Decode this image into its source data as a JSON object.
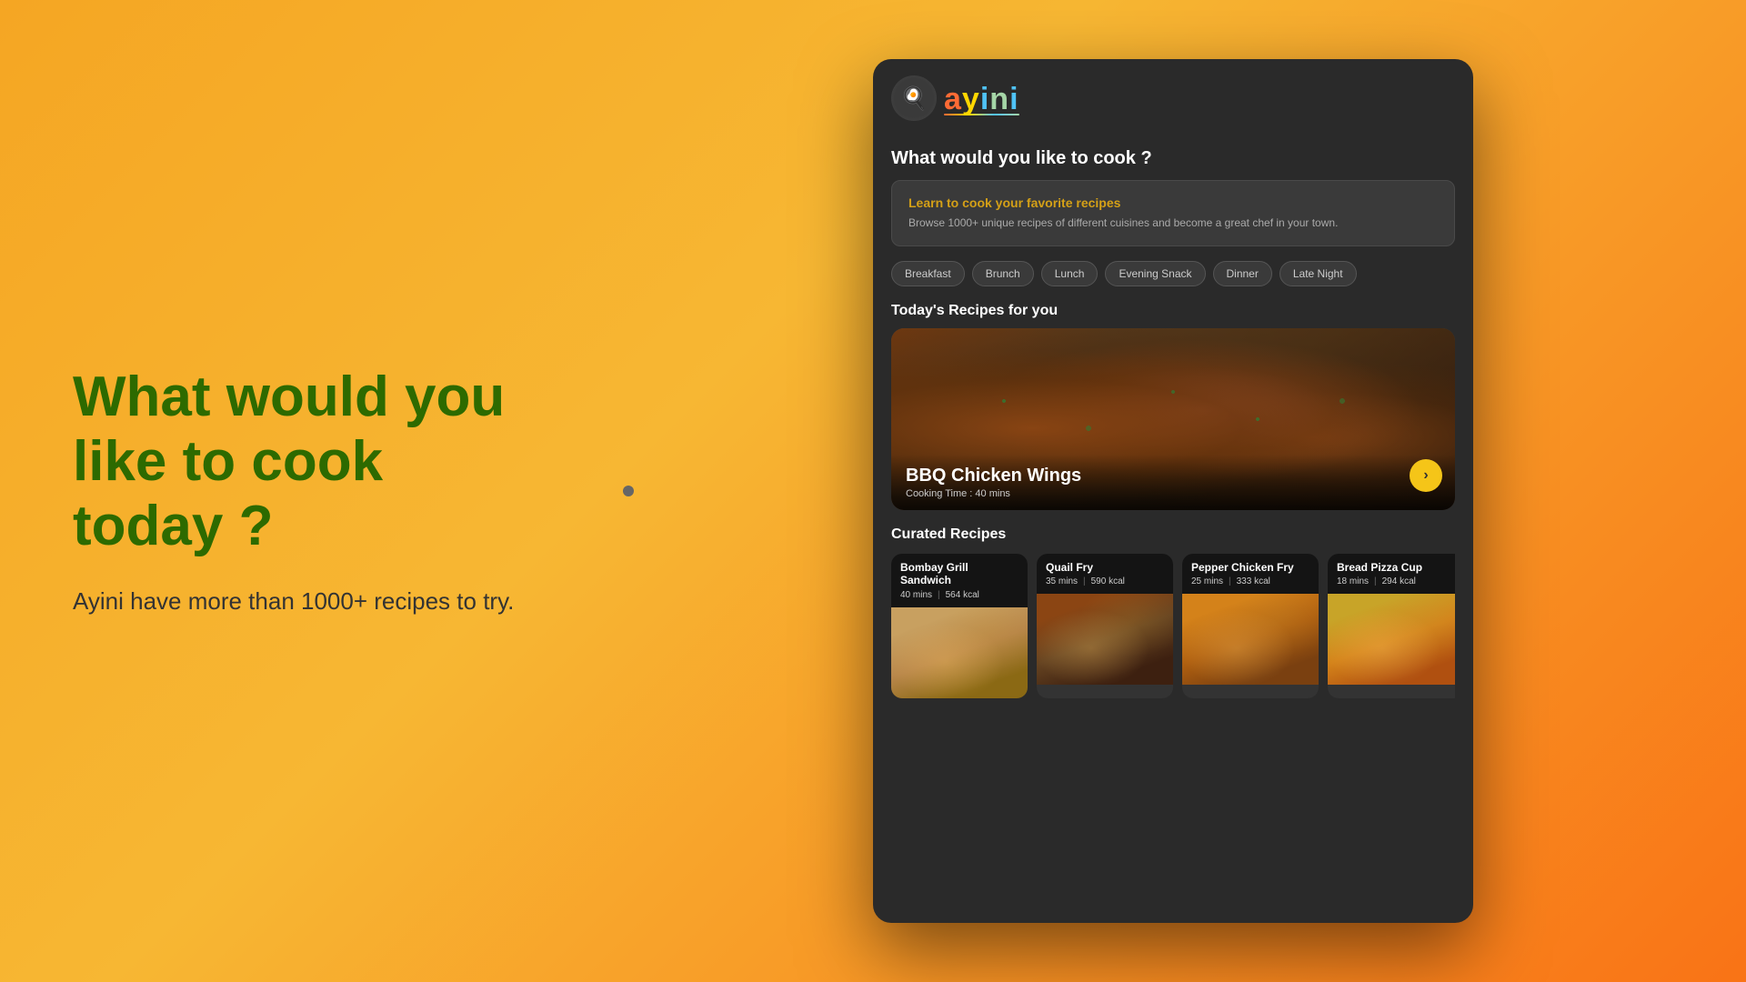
{
  "background": {
    "gradient_start": "#f5a623",
    "gradient_end": "#f97316"
  },
  "left": {
    "title": "What would you like to cook today ?",
    "subtitle": "Ayini have more than 1000+ recipes to try."
  },
  "app": {
    "logo": {
      "icon": "🍳",
      "text_letters": [
        "a",
        "y",
        "i",
        "n",
        "i"
      ],
      "full_text": "ayini"
    },
    "main_question": "What would you like to cook ?",
    "banner": {
      "title": "Learn to cook your favorite recipes",
      "description": "Browse 1000+ unique recipes of different cuisines and become a great chef in your town."
    },
    "meal_tags": [
      "Breakfast",
      "Brunch",
      "Lunch",
      "Evening Snack",
      "Dinner",
      "Late Night"
    ],
    "todays_recipes_label": "Today's Recipes for you",
    "featured_recipe": {
      "name": "BBQ Chicken Wings",
      "cooking_time_label": "Cooking Time : 40 mins"
    },
    "curated_label": "Curated Recipes",
    "curated_recipes": [
      {
        "name": "Bombay Grill Sandwich",
        "mins": "40 mins",
        "kcal": "564 kcal",
        "food_class": "food-bombay"
      },
      {
        "name": "Quail Fry",
        "mins": "35 mins",
        "kcal": "590 kcal",
        "food_class": "food-quail"
      },
      {
        "name": "Pepper Chicken Fry",
        "mins": "25 mins",
        "kcal": "333 kcal",
        "food_class": "food-pepper"
      },
      {
        "name": "Bread Pizza Cup",
        "mins": "18 mins",
        "kcal": "294 kcal",
        "food_class": "food-pizza"
      }
    ],
    "next_btn_label": "›"
  }
}
